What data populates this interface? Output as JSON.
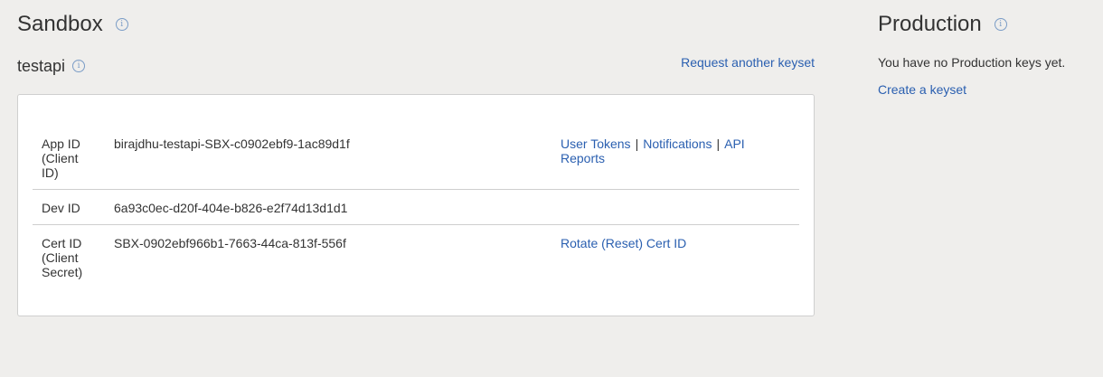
{
  "sandbox": {
    "title": "Sandbox",
    "info_icon": "info-icon",
    "app_name": "testapi",
    "request_link": "Request another keyset",
    "rows": [
      {
        "label": "App ID (Client ID)",
        "value": "birajdhu-testapi-SBX-c0902ebf9-1ac89d1f",
        "actions": [
          "User Tokens",
          "Notifications",
          "API Reports"
        ]
      },
      {
        "label": "Dev ID",
        "value": "6a93c0ec-d20f-404e-b826-e2f74d13d1d1",
        "actions": []
      },
      {
        "label": "Cert ID (Client Secret)",
        "value": "SBX-0902ebf966b1-7663-44ca-813f-556f",
        "actions": [
          "Rotate (Reset) Cert ID"
        ]
      }
    ],
    "action_separator": "|"
  },
  "production": {
    "title": "Production",
    "info_icon": "info-icon",
    "message": "You have no Production keys yet.",
    "create_link": "Create a keyset"
  },
  "colors": {
    "background": "#efeeec",
    "link": "#2a5fb0",
    "text": "#333333",
    "card": "#ffffff",
    "border": "#cfcfcf",
    "info_icon": "#7a9cc6"
  }
}
